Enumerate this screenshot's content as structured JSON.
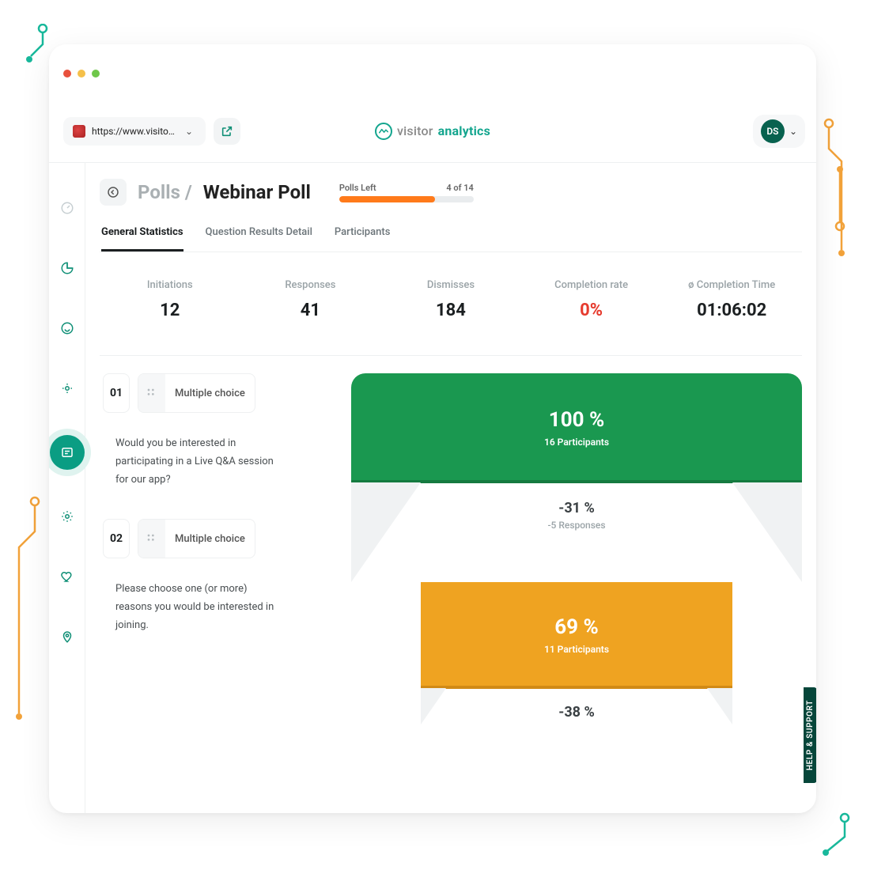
{
  "browser": {
    "url_display": "https://www.visitor-anal...",
    "brand_part1": "visitor",
    "brand_part2": "analytics",
    "avatar_initials": "DS"
  },
  "breadcrumb": {
    "parent": "Polls /",
    "current": "Webinar Poll"
  },
  "polls_left": {
    "label": "Polls Left",
    "count_text": "4 of 14",
    "fill_pct": 71
  },
  "tabs": [
    {
      "label": "General Statistics",
      "active": true
    },
    {
      "label": "Question Results Detail",
      "active": false
    },
    {
      "label": "Participants",
      "active": false
    }
  ],
  "stats": {
    "initiations": {
      "label": "Initiations",
      "value": "12"
    },
    "responses": {
      "label": "Responses",
      "value": "41"
    },
    "dismisses": {
      "label": "Dismisses",
      "value": "184"
    },
    "completion_rate": {
      "label": "Completion rate",
      "value": "0%"
    },
    "completion_time": {
      "label": "ø Completion Time",
      "value": "01:06:02"
    }
  },
  "questions": [
    {
      "num": "01",
      "type": "Multiple choice",
      "text": "Would you be interested in participating in a Live Q&A session for our app?"
    },
    {
      "num": "02",
      "type": "Multiple choice",
      "text": "Please choose one (or more) reasons you would be interested in joining."
    }
  ],
  "funnel": {
    "step1": {
      "pct": "100 %",
      "sub": "16 Participants"
    },
    "drop1": {
      "pct": "-31 %",
      "sub": "-5 Responses"
    },
    "step2": {
      "pct": "69 %",
      "sub": "11 Participants"
    },
    "drop2": {
      "pct": "-38 %"
    }
  },
  "help_tab": "HELP & SUPPORT",
  "colors": {
    "brand_teal": "#13a58e",
    "funnel_green": "#1a9850",
    "funnel_orange": "#efa321",
    "progress_orange": "#ff7a1a",
    "danger_red": "#e63b2e"
  }
}
